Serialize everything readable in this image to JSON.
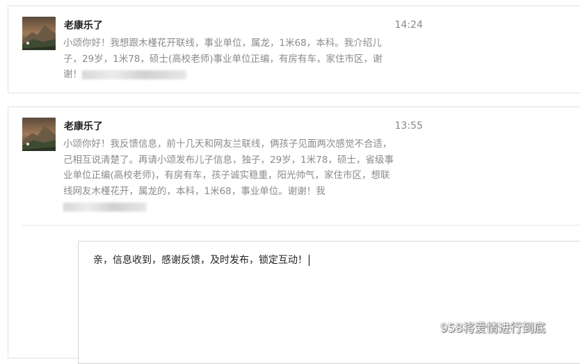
{
  "messages": [
    {
      "sender": "老康乐了",
      "time": "14:24",
      "text": "小颂你好！我想跟木槿花开联线，事业单位，属龙，1米68，本科。我介绍儿子，29岁，1米78，硕士(高校老师)事业单位正编，有房有车，家住市区，谢谢！"
    },
    {
      "sender": "老康乐了",
      "time": "13:55",
      "text": "小颂你好！我反馈信息，前十几天和网友兰联线，俩孩子见面两次感觉不合适，己相互说清楚了。再请小颂发布儿子信息，独子，29岁，1米78，硕士，省级事业单位正编(高校老师)，有房有车，孩子诚实稳重，阳光帅气，家住市区，想联线网友木槿花开，属龙的，本科，1米68，事业单位。谢谢！我"
    }
  ],
  "reply": {
    "text": "亲，信息收到，感谢反馈，及时发布，锁定互动！"
  },
  "watermark": {
    "icon": "wechat-icon",
    "text": "958将爱情进行到底"
  },
  "colors": {
    "message_text": "#8a8a8a",
    "border": "#e2e2e2"
  }
}
